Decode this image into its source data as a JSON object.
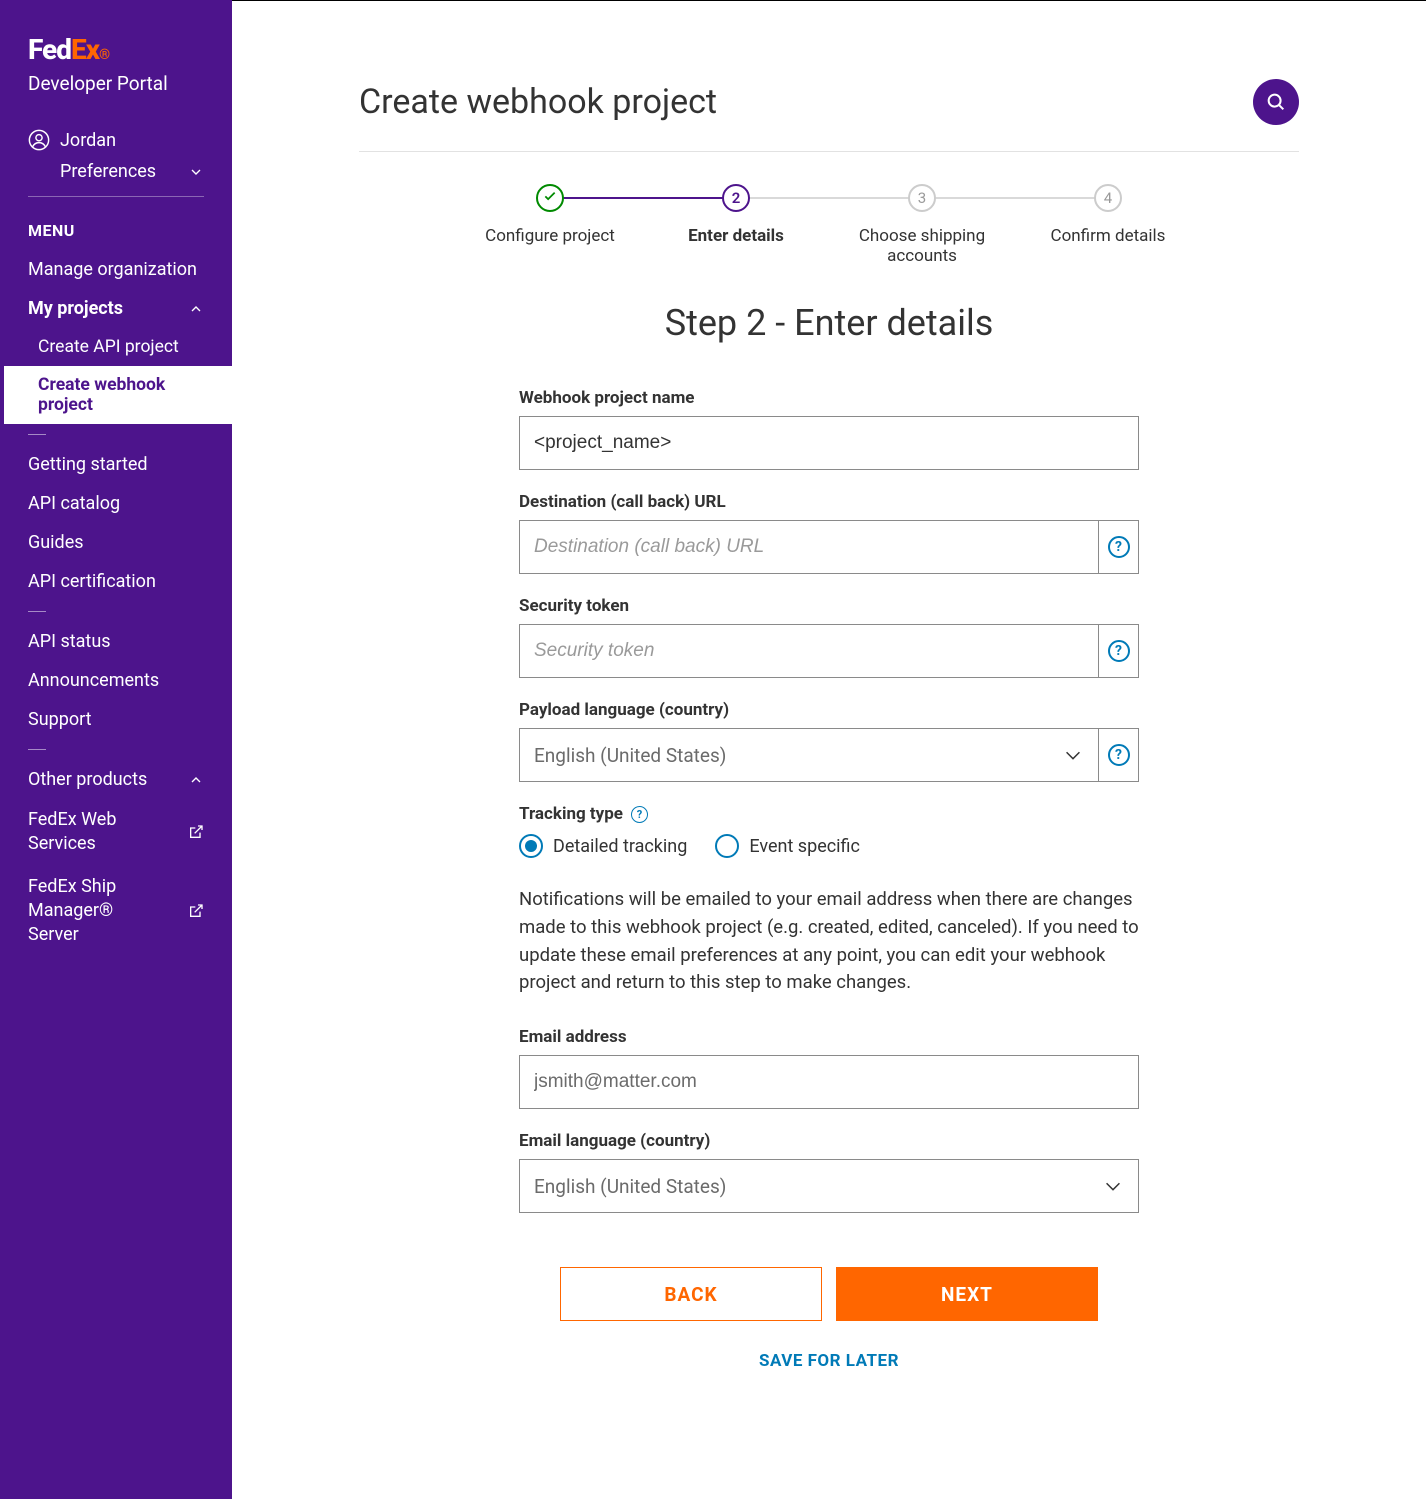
{
  "brand": {
    "fed": "Fed",
    "ex": "Ex",
    "sub": "Developer Portal"
  },
  "user": {
    "name": "Jordan",
    "prefs": "Preferences"
  },
  "menu": {
    "header": "MENU",
    "manage_org": "Manage organization",
    "my_projects": "My projects",
    "create_api": "Create API project",
    "create_webhook": "Create webhook project",
    "getting_started": "Getting started",
    "api_catalog": "API catalog",
    "guides": "Guides",
    "api_cert": "API certification",
    "api_status": "API status",
    "announcements": "Announcements",
    "support": "Support",
    "other_products": "Other products",
    "fedex_web_services": "FedEx Web Services",
    "fedex_ship_manager": "FedEx Ship Manager® Server"
  },
  "page": {
    "title": "Create webhook project",
    "step_heading": "Step 2 - Enter details"
  },
  "steps": [
    {
      "num": "1",
      "label": "Configure project",
      "state": "done"
    },
    {
      "num": "2",
      "label": "Enter details",
      "state": "current"
    },
    {
      "num": "3",
      "label": "Choose shipping accounts",
      "state": "future"
    },
    {
      "num": "4",
      "label": "Confirm details",
      "state": "future"
    }
  ],
  "form": {
    "project_name_label": "Webhook project name",
    "project_name_value": "<project_name>",
    "dest_url_label": "Destination (call back) URL",
    "dest_url_placeholder": "Destination (call back) URL",
    "token_label": "Security token",
    "token_placeholder": "Security token",
    "payload_lang_label": "Payload language (country)",
    "payload_lang_value": "English (United States)",
    "tracking_type_label": "Tracking type",
    "tracking_detailed": "Detailed tracking",
    "tracking_event": "Event specific",
    "note": "Notifications will be emailed to your email address when there are changes made to this webhook project (e.g. created, edited, canceled). If you need to update these email preferences at any point, you can edit your webhook project and return to this step to make changes.",
    "email_label": "Email address",
    "email_value": "jsmith@matter.com",
    "email_lang_label": "Email language (country)",
    "email_lang_value": "English (United States)"
  },
  "buttons": {
    "back": "BACK",
    "next": "NEXT",
    "save": "SAVE FOR LATER"
  }
}
